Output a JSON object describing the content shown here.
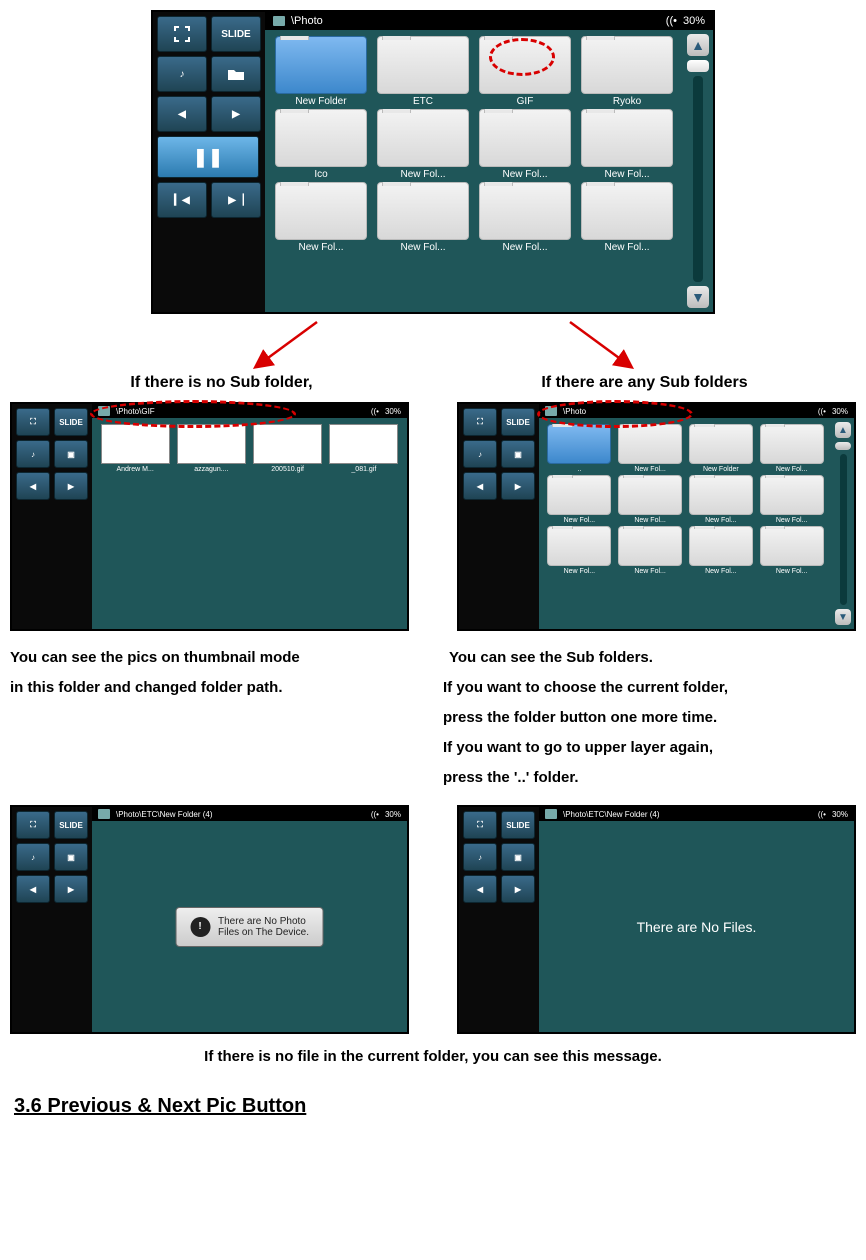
{
  "topDevice": {
    "path": "\\Photo",
    "battery": "30%",
    "sideLabels": {
      "slide": "SLIDE"
    },
    "folders": [
      {
        "name": "New Folder",
        "selected": true
      },
      {
        "name": "ETC"
      },
      {
        "name": "GIF",
        "marked": true
      },
      {
        "name": "Ryoko"
      },
      {
        "name": "Ico"
      },
      {
        "name": "New Fol..."
      },
      {
        "name": "New Fol..."
      },
      {
        "name": "New Fol..."
      },
      {
        "name": "New Fol..."
      },
      {
        "name": "New Fol..."
      },
      {
        "name": "New Fol..."
      },
      {
        "name": "New Fol..."
      }
    ]
  },
  "captions": {
    "leftTitle": "If there is no Sub folder,",
    "rightTitle": "If there are any Sub folders"
  },
  "leftDevice": {
    "path": "\\Photo\\GIF",
    "battery": "30%",
    "slide": "SLIDE",
    "thumbs": [
      {
        "label": "Andrew M..."
      },
      {
        "label": "azzagun...."
      },
      {
        "label": "200510.gif"
      },
      {
        "label": "_081.gif"
      }
    ]
  },
  "rightDevice": {
    "path": "\\Photo",
    "battery": "30%",
    "slide": "SLIDE",
    "folders": [
      {
        "name": "..",
        "selected": true
      },
      {
        "name": "New Fol...",
        "marked": true
      },
      {
        "name": "New Folder"
      },
      {
        "name": "New Fol..."
      },
      {
        "name": "New Fol..."
      },
      {
        "name": "New Fol..."
      },
      {
        "name": "New Fol..."
      },
      {
        "name": "New Fol..."
      },
      {
        "name": "New Fol..."
      },
      {
        "name": "New Fol..."
      },
      {
        "name": "New Fol..."
      },
      {
        "name": "New Fol..."
      }
    ]
  },
  "descriptions": {
    "leftLine1": "You can see the pics on thumbnail mode",
    "leftLine2": "in this folder and changed folder path.",
    "rightLine1": "You can see the Sub folders.",
    "rightLine2": "If you want to choose the current folder,",
    "rightLine3": "press the folder button one more time.",
    "rightLine4": "If you want to go to upper layer again,",
    "rightLine5": "press the '..' folder."
  },
  "bottomLeftDevice": {
    "path": "\\Photo\\ETC\\New Folder (4)",
    "battery": "30%",
    "slide": "SLIDE",
    "dialogLine1": "There are No Photo",
    "dialogLine2": "Files on The Device."
  },
  "bottomRightDevice": {
    "path": "\\Photo\\ETC\\New Folder (4)",
    "battery": "30%",
    "slide": "SLIDE",
    "message": "There are No Files."
  },
  "footerCaption": "If there is no file in the current folder, you can see this message.",
  "sectionHeading": "3.6 Previous & Next Pic Button"
}
